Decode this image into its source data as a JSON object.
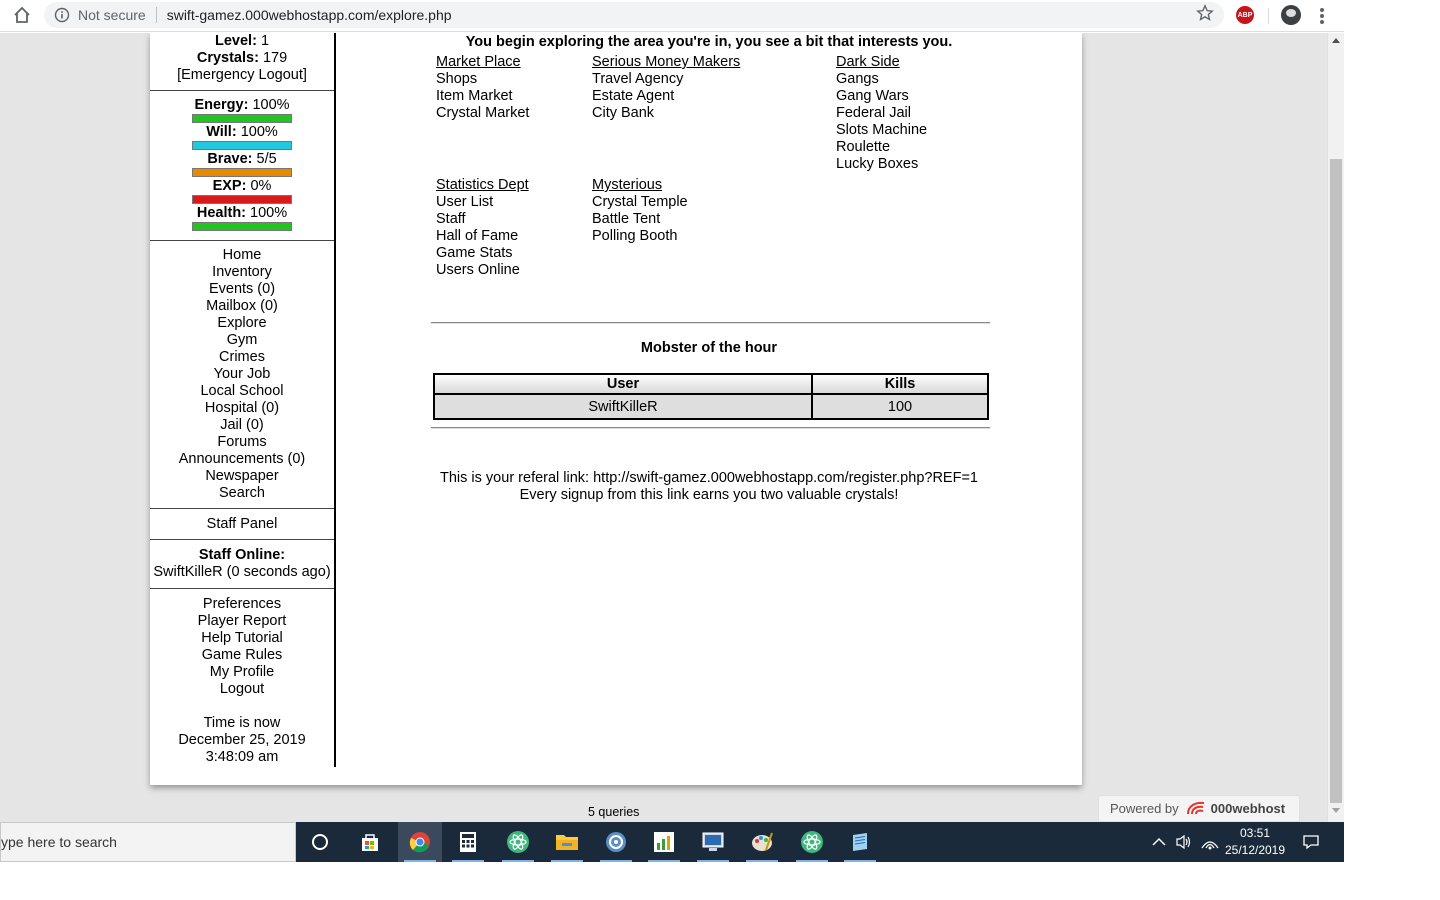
{
  "browser": {
    "security_label": "Not secure",
    "url": "swift-gamez.000webhostapp.com/explore.php",
    "abp_label": "ABP"
  },
  "sidebar": {
    "level_label": "Level:",
    "level_value": "1",
    "crystals_label": "Crystals:",
    "crystals_value": "179",
    "emergency_logout": "[Emergency Logout]",
    "bars": [
      {
        "label": "Energy:",
        "value": "100%",
        "color": "#22c422",
        "fill": 1.0
      },
      {
        "label": "Will:",
        "value": "100%",
        "color": "#22c8e0",
        "fill": 1.0
      },
      {
        "label": "Brave:",
        "value": "5/5",
        "color": "#e68a00",
        "fill": 1.0
      },
      {
        "label": "EXP:",
        "value": "0%",
        "color": "#d91a1a",
        "fill": 1.0
      },
      {
        "label": "Health:",
        "value": "100%",
        "color": "#22c422",
        "fill": 1.0
      }
    ],
    "nav": [
      "Home",
      "Inventory",
      "Events (0)",
      "Mailbox (0)",
      "Explore",
      "Gym",
      "Crimes",
      "Your Job",
      "Local School",
      "Hospital (0)",
      "Jail (0)",
      "Forums",
      "Announcements (0)",
      "Newspaper",
      "Search"
    ],
    "staff_panel": "Staff Panel",
    "staff_online_label": "Staff Online:",
    "staff_online_entry": "SwiftKilleR (0 seconds ago)",
    "links": [
      "Preferences",
      "Player Report",
      "Help Tutorial",
      "Game Rules",
      "My Profile",
      "Logout"
    ],
    "time_label": "Time is now",
    "time_date": "December 25, 2019",
    "time_clock": "3:48:09 am"
  },
  "main": {
    "intro": "You begin exploring the area you're in, you see a bit that interests you.",
    "categories": {
      "market_place": {
        "title": "Market Place",
        "items": [
          "Shops",
          "Item Market",
          "Crystal Market"
        ]
      },
      "serious_money": {
        "title": "Serious Money Makers",
        "items": [
          "Travel Agency",
          "Estate Agent",
          "City Bank"
        ]
      },
      "dark_side": {
        "title": "Dark Side",
        "items": [
          "Gangs",
          "Gang Wars",
          "Federal Jail",
          "Slots Machine",
          "Roulette",
          "Lucky Boxes"
        ]
      },
      "statistics": {
        "title": "Statistics Dept",
        "items": [
          "User List",
          "Staff",
          "Hall of Fame",
          "Game Stats",
          "Users Online"
        ]
      },
      "mysterious": {
        "title": "Mysterious",
        "items": [
          "Crystal Temple",
          "Battle Tent",
          "Polling Booth"
        ]
      }
    },
    "motd_title": "Mobster of the hour",
    "motd_table": {
      "headers": [
        "User",
        "Kills"
      ],
      "rows": [
        [
          "SwiftKilleR",
          "100"
        ]
      ]
    },
    "referral_line1": "This is your referal link: http://swift-gamez.000webhostapp.com/register.php?REF=1",
    "referral_line2": "Every signup from this link earns you two valuable crystals!"
  },
  "footer": {
    "queries": "5 queries",
    "powered_by": "Powered by",
    "host_brand": "000webhost"
  },
  "taskbar": {
    "search_placeholder": "ype here to search",
    "time": "03:51",
    "date": "25/12/2019"
  }
}
